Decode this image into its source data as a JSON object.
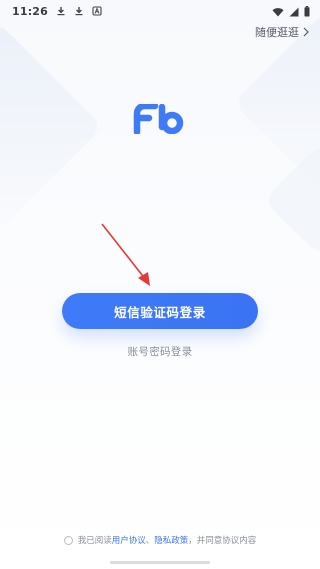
{
  "status_bar": {
    "time": "11:26",
    "left_icons": [
      "download-icon",
      "download-icon",
      "app-notification-icon"
    ],
    "right_icons": [
      "wifi-icon",
      "signal-icon",
      "battery-icon"
    ]
  },
  "header": {
    "browse_label": "随便逛逛"
  },
  "logo": {
    "text": "Fb",
    "color": "#3f7bf8"
  },
  "main": {
    "sms_login_label": "短信验证码登录",
    "password_login_label": "账号密码登录"
  },
  "agreement": {
    "checked": false,
    "prefix": "我已阅读",
    "user_agreement": "用户协议",
    "separator": "、",
    "privacy_policy": "隐私政策",
    "suffix": "，并同意协议内容"
  },
  "colors": {
    "accent": "#3f7bf8",
    "link": "#3d76f5",
    "annotation_arrow": "#e53935"
  }
}
